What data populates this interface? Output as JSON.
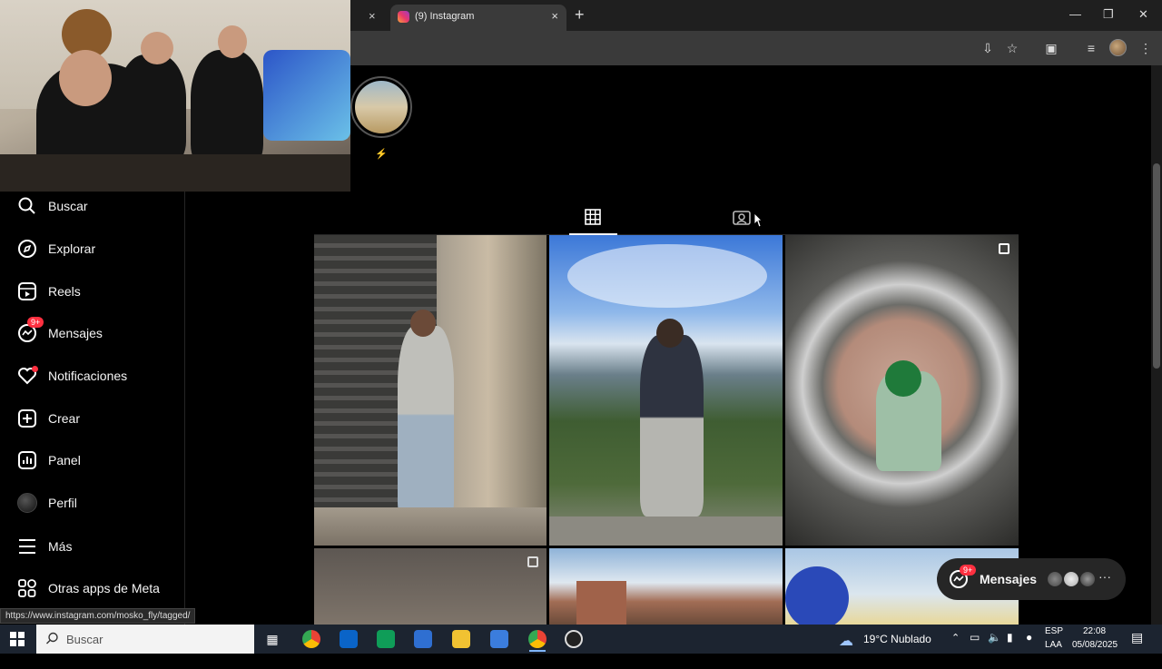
{
  "browser": {
    "active_tab_title": "(9) Instagram",
    "prev_tab_close": "×",
    "active_tab_close": "×",
    "new_tab": "+"
  },
  "sidebar": {
    "items": [
      {
        "label": "Buscar",
        "icon": "search-icon"
      },
      {
        "label": "Explorar",
        "icon": "compass-icon"
      },
      {
        "label": "Reels",
        "icon": "reels-icon"
      },
      {
        "label": "Mensajes",
        "icon": "messenger-icon",
        "badge": "9+"
      },
      {
        "label": "Notificaciones",
        "icon": "heart-icon"
      },
      {
        "label": "Crear",
        "icon": "plus-square-icon"
      },
      {
        "label": "Panel",
        "icon": "chart-icon"
      },
      {
        "label": "Perfil",
        "icon": "avatar-icon"
      },
      {
        "label": "Más",
        "icon": "menu-icon"
      },
      {
        "label": "Otras apps de Meta",
        "icon": "meta-apps-icon"
      }
    ]
  },
  "profile": {
    "highlight_label": "⚡",
    "tabs": [
      {
        "name": "posts",
        "icon": "grid-icon",
        "active": true
      },
      {
        "name": "tagged",
        "icon": "tagged-icon",
        "active": false
      }
    ]
  },
  "messages_pill": {
    "label": "Mensajes",
    "badge": "9+",
    "more": "···"
  },
  "status_url": "https://www.instagram.com/mosko_fly/tagged/",
  "taskbar": {
    "search_placeholder": "Buscar",
    "weather": "19°C  Nublado",
    "lang_top": "ESP",
    "lang_bottom": "LAA",
    "time": "22:08",
    "date": "05/08/2025"
  },
  "colors": {
    "background": "#000000",
    "badge": "#ff3040",
    "sidebar_text": "#f5f5f5",
    "pill_bg": "#262626"
  }
}
